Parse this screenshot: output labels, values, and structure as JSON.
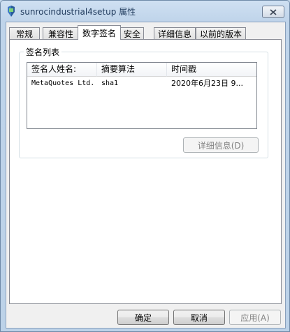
{
  "window": {
    "title": "sunrocindustrial4setup 属性",
    "app_icon": "installer-icon",
    "close_icon": "close-icon"
  },
  "tabs": [
    {
      "label": "常规",
      "active": false
    },
    {
      "label": "兼容性",
      "active": false
    },
    {
      "label": "数字签名",
      "active": true
    },
    {
      "label": "安全",
      "active": false
    },
    {
      "label": "详细信息",
      "active": false
    },
    {
      "label": "以前的版本",
      "active": false
    }
  ],
  "signatures": {
    "group_label": "签名列表",
    "columns": [
      "签名人姓名:",
      "摘要算法",
      "时间戳"
    ],
    "rows": [
      {
        "signer": "MetaQuotes Ltd.",
        "digest": "sha1",
        "timestamp": "2020年6月23日 9..."
      }
    ],
    "details_button": "详细信息(D)"
  },
  "footer": {
    "ok": "确定",
    "cancel": "取消",
    "apply": "应用(A)"
  }
}
